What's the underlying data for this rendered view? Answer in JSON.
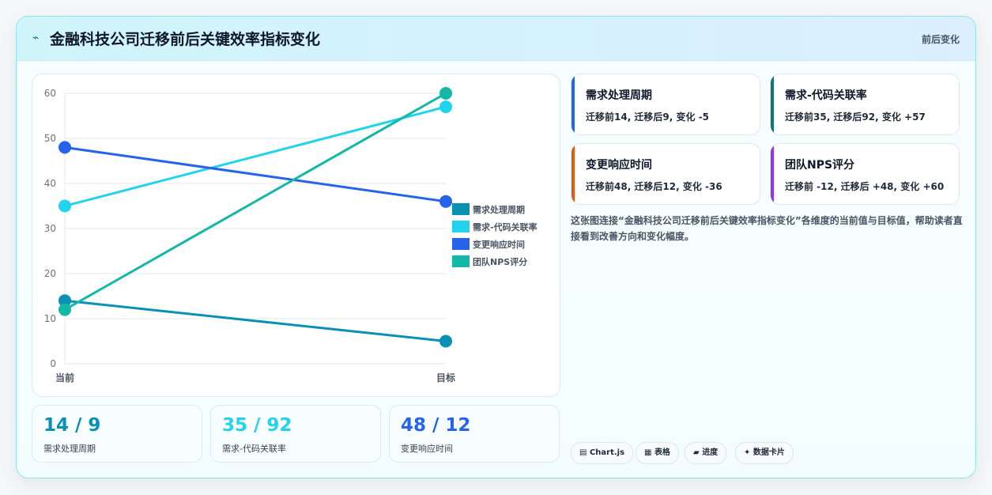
{
  "header": {
    "title": "金融科技公司迁移前后关键效率指标变化",
    "meta": "前后变化"
  },
  "chart_data": {
    "type": "line",
    "x": [
      "当前",
      "目标"
    ],
    "ylim": [
      0,
      60
    ],
    "yticks": [
      0,
      10,
      20,
      30,
      40,
      50,
      60
    ],
    "legend_position": "right",
    "grid": true,
    "series": [
      {
        "name": "需求处理周期",
        "values": [
          14,
          5
        ],
        "color": "#0891b2"
      },
      {
        "name": "需求-代码关联率",
        "values": [
          35,
          57
        ],
        "color": "#22d3ee"
      },
      {
        "name": "变更响应时间",
        "values": [
          48,
          36
        ],
        "color": "#2563eb"
      },
      {
        "name": "团队NPS评分",
        "values": [
          12,
          60
        ],
        "color": "#14b8a6"
      }
    ]
  },
  "stats": [
    {
      "value": "14 / 9",
      "label": "需求处理周期",
      "color": "#0891b2"
    },
    {
      "value": "35 / 92",
      "label": "需求-代码关联率",
      "color": "#22d3ee"
    },
    {
      "value": "48 / 12",
      "label": "变更响应时间",
      "color": "#2563eb"
    }
  ],
  "metrics": [
    {
      "title": "需求处理周期",
      "detail": "迁移前14, 迁移后9, 变化 -5",
      "color": "#2563eb"
    },
    {
      "title": "需求-代码关联率",
      "detail": "迁移前35, 迁移后92, 变化 +57",
      "color": "#0f766e"
    },
    {
      "title": "变更响应时间",
      "detail": "迁移前48, 迁移后12, 变化 -36",
      "color": "#ea580c"
    },
    {
      "title": "团队NPS评分",
      "detail": "迁移前 -12, 迁移后 +48, 变化 +60",
      "color": "#9333ea"
    }
  ],
  "description": "这张图连接“金融科技公司迁移前后关键效率指标变化”各维度的当前值与目标值，帮助读者直接看到改善方向和变化幅度。",
  "tags": [
    {
      "label": "Chart.js",
      "icon": "▤"
    },
    {
      "label": "表格",
      "icon": "▦"
    },
    {
      "label": "进度",
      "icon": "▰"
    },
    {
      "label": "数据卡片",
      "icon": "✦"
    }
  ]
}
